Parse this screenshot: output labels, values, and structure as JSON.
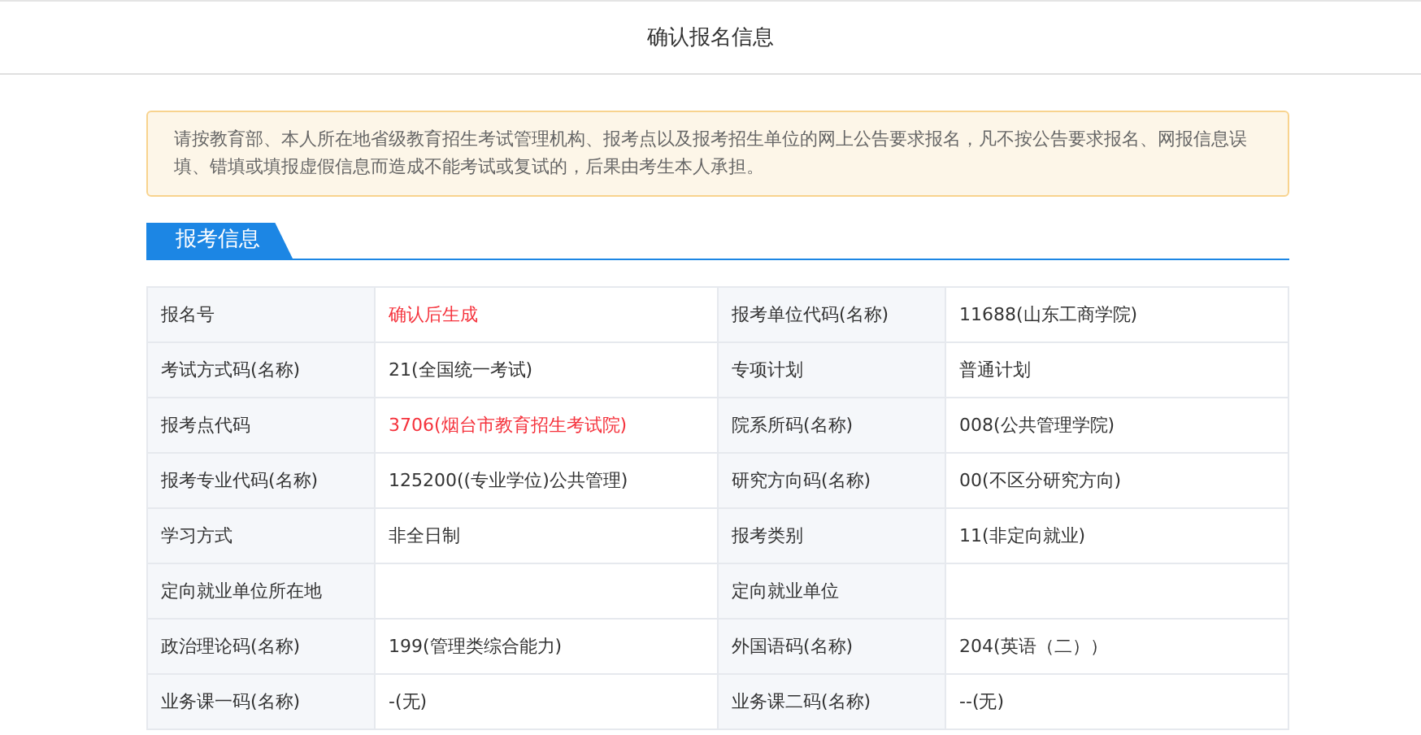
{
  "header": {
    "title": "确认报名信息"
  },
  "notice": "请按教育部、本人所在地省级教育招生考试管理机构、报考点以及报考招生单位的网上公告要求报名，凡不按公告要求报名、网报信息误填、错填或填报虚假信息而造成不能考试或复试的，后果由考生本人承担。",
  "section": {
    "title": "报考信息"
  },
  "rows": [
    {
      "label_1": "报名号",
      "value_1": {
        "text": "确认后生成",
        "highlight": true
      },
      "label_2": "报考单位代码(名称)",
      "value_2": {
        "text": "11688(山东工商学院)",
        "highlight": false
      }
    },
    {
      "label_1": "考试方式码(名称)",
      "value_1": {
        "text": "21(全国统一考试)",
        "highlight": false
      },
      "label_2": "专项计划",
      "value_2": {
        "text": "普通计划",
        "highlight": false
      }
    },
    {
      "label_1": "报考点代码",
      "value_1": {
        "text": "3706(烟台市教育招生考试院)",
        "highlight": true
      },
      "label_2": "院系所码(名称)",
      "value_2": {
        "text": "008(公共管理学院)",
        "highlight": false
      }
    },
    {
      "label_1": "报考专业代码(名称)",
      "value_1": {
        "text": "125200((专业学位)公共管理)",
        "highlight": false
      },
      "label_2": "研究方向码(名称)",
      "value_2": {
        "text": "00(不区分研究方向)",
        "highlight": false
      }
    },
    {
      "label_1": "学习方式",
      "value_1": {
        "text": "非全日制",
        "highlight": false
      },
      "label_2": "报考类别",
      "value_2": {
        "text": "11(非定向就业)",
        "highlight": false
      }
    },
    {
      "label_1": "定向就业单位所在地",
      "label_2": "定向就业单位"
    },
    {
      "label_1": "政治理论码(名称)",
      "value_1": {
        "text": "199(管理类综合能力)",
        "highlight": false
      },
      "label_2": "外国语码(名称)",
      "value_2": {
        "text": "204(英语（二））",
        "highlight": false
      }
    },
    {
      "label_1": "业务课一码(名称)",
      "value_1": {
        "text": "-(无)",
        "highlight": false
      },
      "label_2": "业务课二码(名称)",
      "value_2": {
        "text": "--(无)",
        "highlight": false
      }
    }
  ]
}
